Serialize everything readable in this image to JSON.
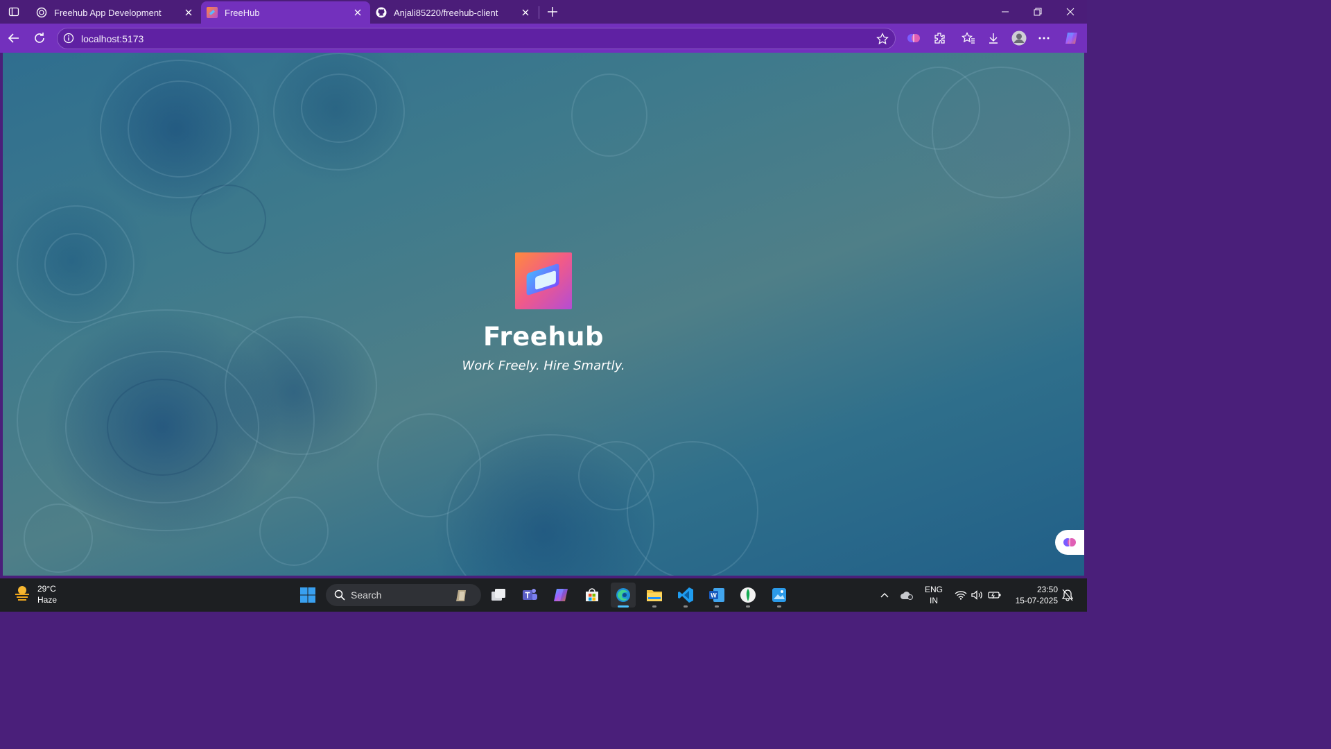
{
  "browser": {
    "tabs": [
      {
        "title": "Freehub App Development",
        "icon": "openai-icon",
        "active": false
      },
      {
        "title": "FreeHub",
        "icon": "freehub-favicon",
        "active": true
      },
      {
        "title": "Anjali85220/freehub-client",
        "icon": "github-icon",
        "active": false
      }
    ],
    "url": "localhost:5173"
  },
  "page": {
    "brand": "Freehub",
    "tagline": "Work Freely. Hire Smartly."
  },
  "taskbar": {
    "weather": {
      "temp": "29°C",
      "condition": "Haze"
    },
    "search_label": "Search",
    "lang": {
      "line1": "ENG",
      "line2": "IN"
    },
    "clock": {
      "time": "23:50",
      "date": "15-07-2025"
    }
  },
  "colors": {
    "tabstrip": "#4b1d79",
    "toolbar": "#7330bd",
    "taskbar": "#1d1f22"
  }
}
